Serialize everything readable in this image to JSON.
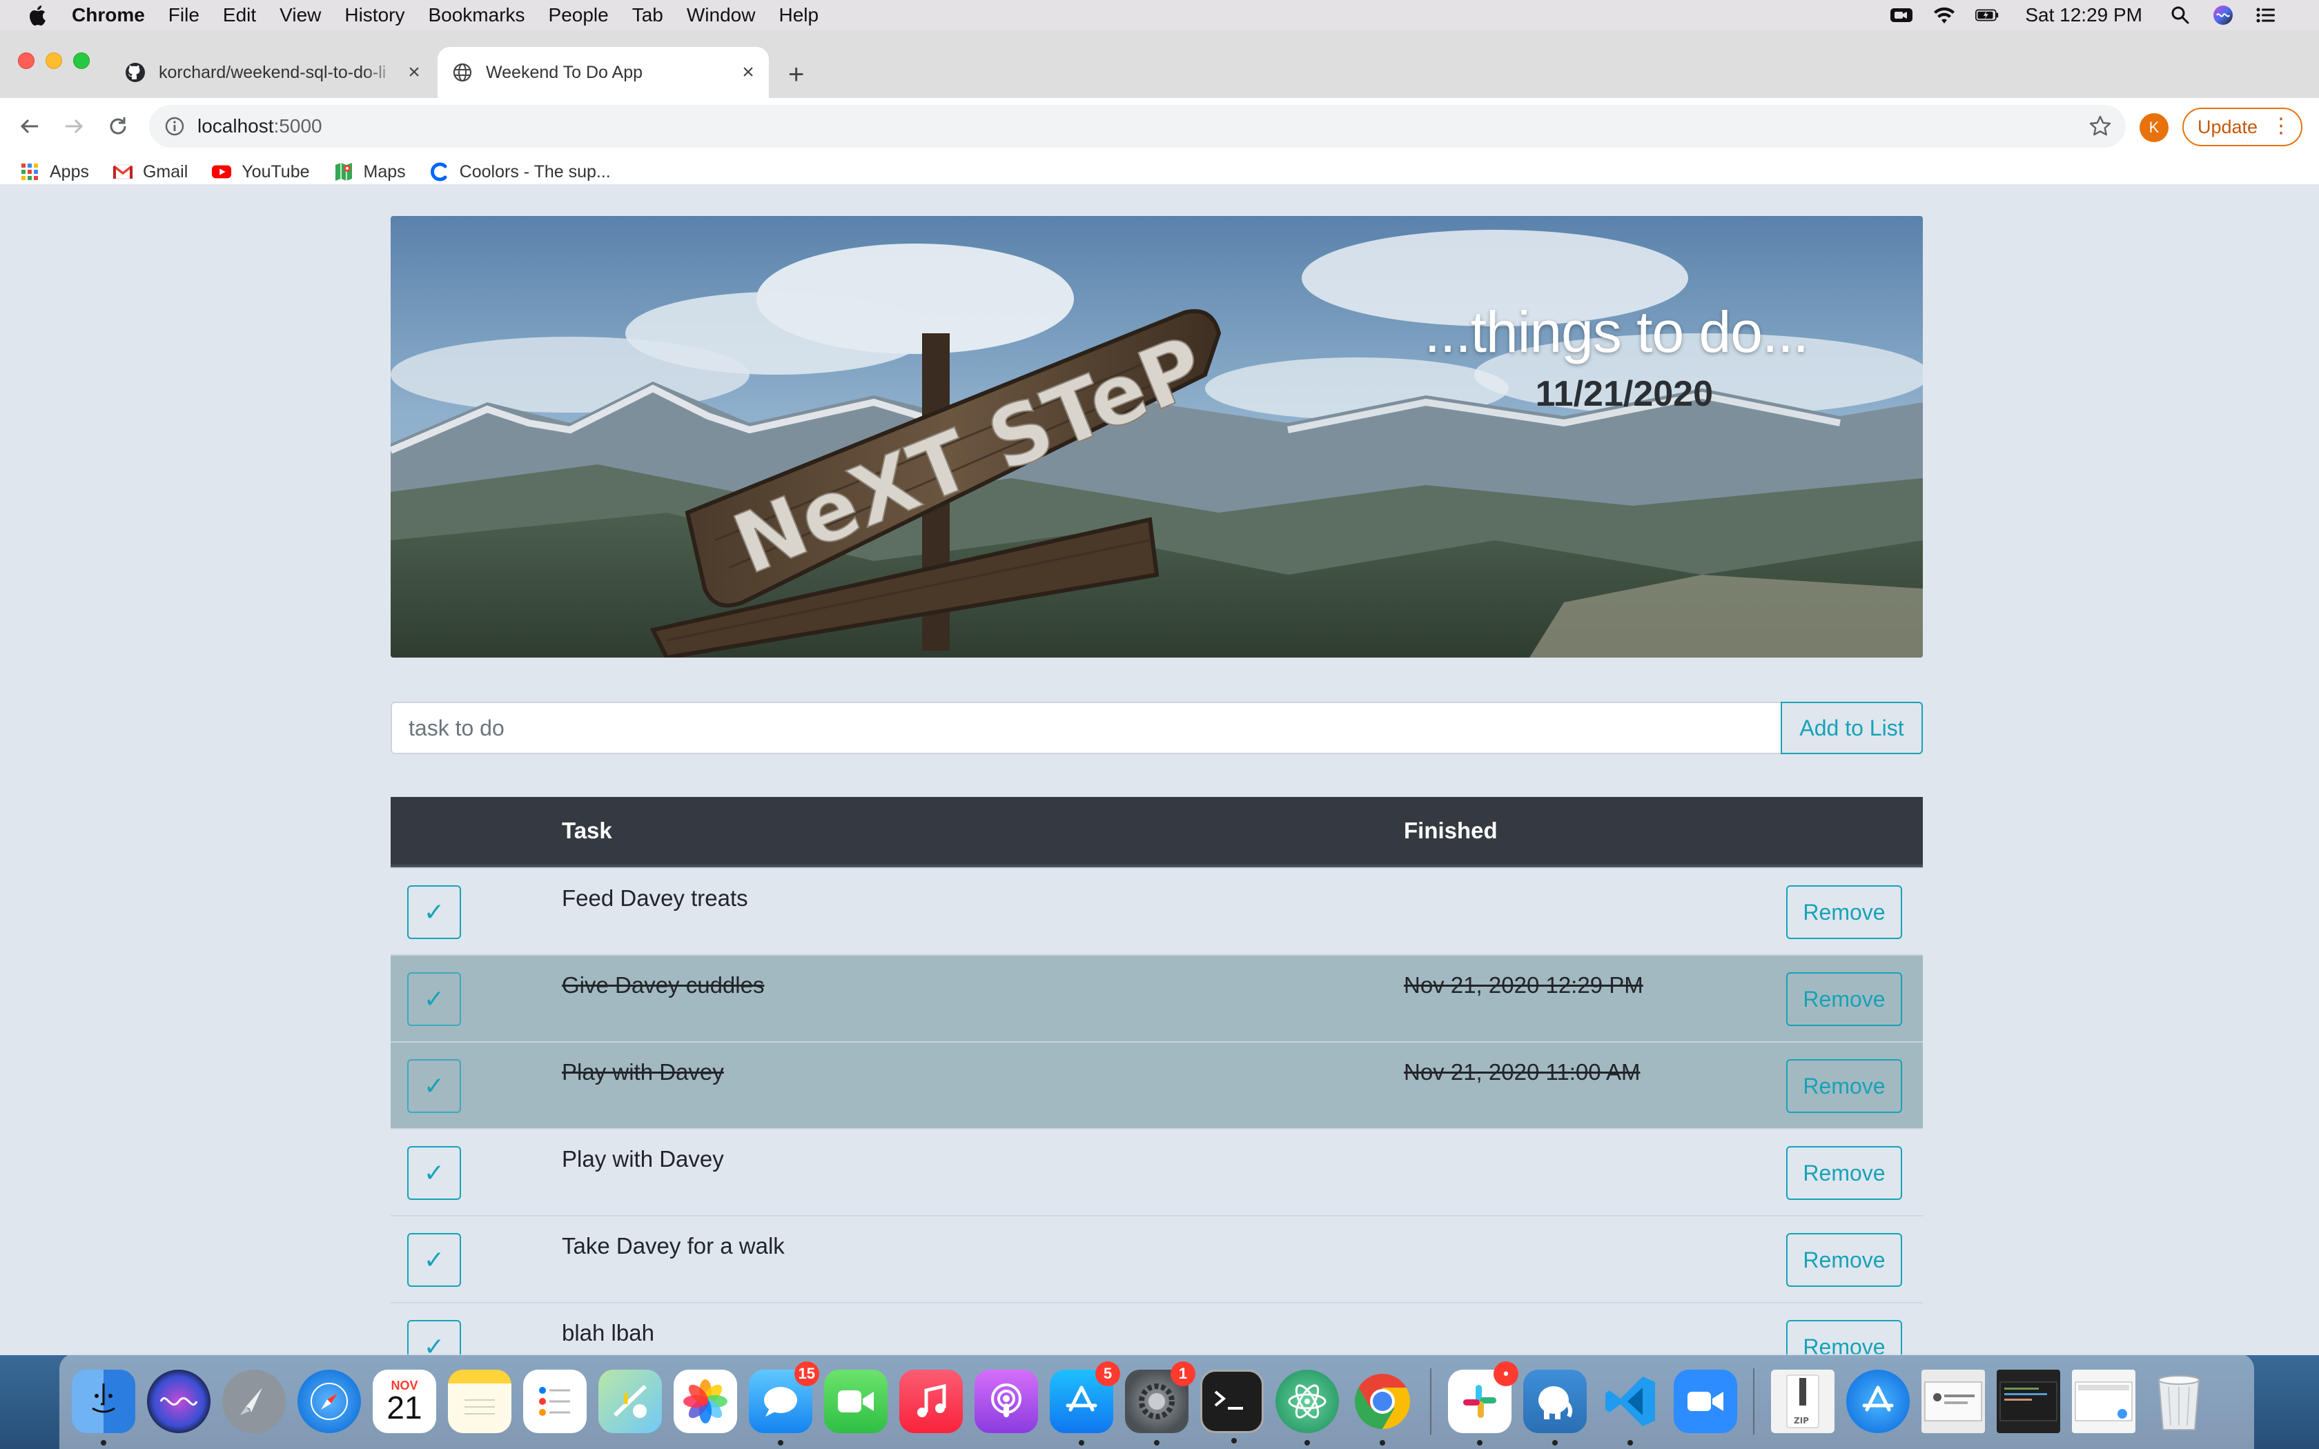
{
  "menubar": {
    "app_name": "Chrome",
    "items": [
      "File",
      "Edit",
      "View",
      "History",
      "Bookmarks",
      "People",
      "Tab",
      "Window",
      "Help"
    ],
    "clock": "Sat 12:29 PM",
    "status_icons": [
      "facetime-icon",
      "wifi-icon",
      "battery-icon",
      "spotlight-icon",
      "siri-icon",
      "control-center-icon"
    ]
  },
  "tabs": [
    {
      "title": "korchard/weekend-sql-to-do-li",
      "favicon": "github-icon",
      "active": false
    },
    {
      "title": "Weekend To Do App",
      "favicon": "globe-icon",
      "active": true
    }
  ],
  "toolbar": {
    "url_host": "localhost",
    "url_port": ":5000",
    "profile_initial": "K",
    "update_label": "Update"
  },
  "bookmarks": [
    {
      "label": "Apps",
      "icon": "apps-grid-icon"
    },
    {
      "label": "Gmail",
      "icon": "gmail-icon"
    },
    {
      "label": "YouTube",
      "icon": "youtube-icon"
    },
    {
      "label": "Maps",
      "icon": "maps-icon"
    },
    {
      "label": "Coolors - The sup...",
      "icon": "coolors-icon"
    }
  ],
  "hero": {
    "title": "...things to do...",
    "date": "11/21/2020",
    "sign_text": "NeXT STeP"
  },
  "form": {
    "placeholder": "task to do",
    "add_label": "Add to List"
  },
  "table": {
    "headers": {
      "task": "Task",
      "finished": "Finished"
    },
    "check_mark": "✓",
    "remove_label": "Remove",
    "rows": [
      {
        "task": "Feed Davey treats",
        "finished": "",
        "done": false
      },
      {
        "task": "Give Davey cuddles",
        "finished": "Nov 21, 2020 12:29 PM",
        "done": true
      },
      {
        "task": "Play with Davey",
        "finished": "Nov 21, 2020 11:00 AM",
        "done": true
      },
      {
        "task": "Play with Davey",
        "finished": "",
        "done": false
      },
      {
        "task": "Take Davey for a walk",
        "finished": "",
        "done": false
      },
      {
        "task": "blah lbah",
        "finished": "",
        "done": false
      }
    ]
  },
  "colors": {
    "accent": "#17a2b8",
    "table_header": "#343a40",
    "done_row": "#a3b9c1",
    "page_bg": "#dfe6ee",
    "update_orange": "#e8710a"
  },
  "dock": {
    "calendar_month": "NOV",
    "calendar_day": "21",
    "items": [
      {
        "name": "finder",
        "badge": ""
      },
      {
        "name": "siri",
        "badge": ""
      },
      {
        "name": "launchpad",
        "badge": ""
      },
      {
        "name": "safari",
        "badge": ""
      },
      {
        "name": "calendar",
        "badge": ""
      },
      {
        "name": "notes",
        "badge": ""
      },
      {
        "name": "reminders",
        "badge": ""
      },
      {
        "name": "maps",
        "badge": ""
      },
      {
        "name": "photos",
        "badge": ""
      },
      {
        "name": "messages",
        "badge": "15"
      },
      {
        "name": "facetime",
        "badge": ""
      },
      {
        "name": "music",
        "badge": ""
      },
      {
        "name": "podcasts",
        "badge": ""
      },
      {
        "name": "app-store",
        "badge": "5"
      },
      {
        "name": "system-preferences",
        "badge": "1"
      },
      {
        "name": "terminal",
        "badge": ""
      },
      {
        "name": "atom",
        "badge": ""
      },
      {
        "name": "chrome",
        "badge": ""
      },
      {
        "name": "slack",
        "badge": "•"
      },
      {
        "name": "postico",
        "badge": ""
      },
      {
        "name": "vscode",
        "badge": ""
      },
      {
        "name": "zoom",
        "badge": ""
      },
      {
        "name": "archive-file",
        "badge": ""
      },
      {
        "name": "app-store-downloads",
        "badge": ""
      },
      {
        "name": "screenshot-1",
        "badge": ""
      },
      {
        "name": "screenshot-2",
        "badge": ""
      },
      {
        "name": "screenshot-3",
        "badge": ""
      },
      {
        "name": "trash",
        "badge": ""
      }
    ]
  }
}
